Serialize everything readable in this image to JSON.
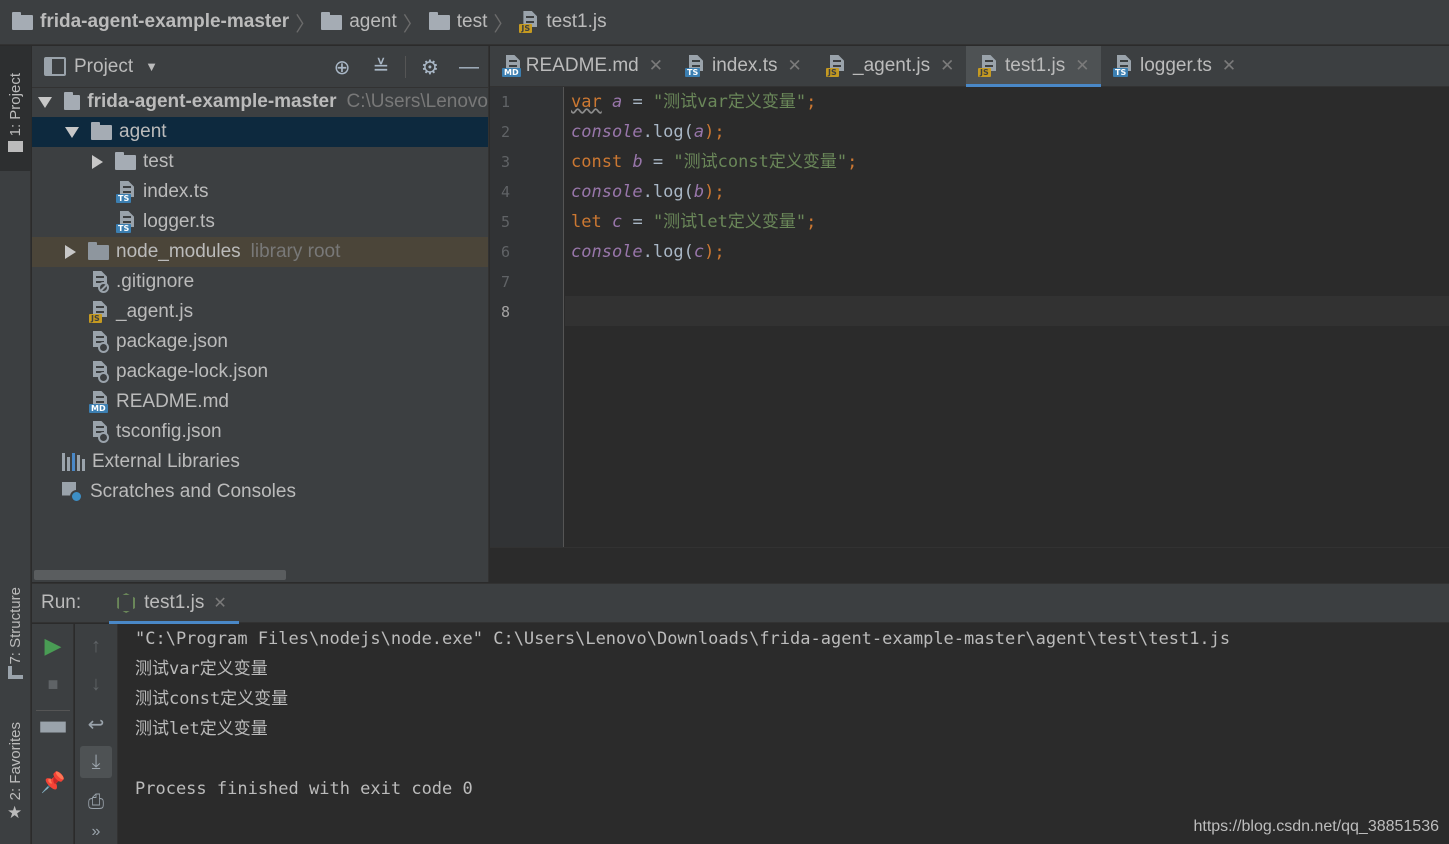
{
  "breadcrumb": [
    "frida-agent-example-master",
    "agent",
    "test",
    "test1.js"
  ],
  "left_strip": {
    "project_tab": "1: Project",
    "structure_tab": "7: Structure",
    "favorites_tab": "2: Favorites"
  },
  "project_panel": {
    "title": "Project",
    "tree": [
      {
        "label": "frida-agent-example-master",
        "hint": "C:\\Users\\Lenovo",
        "icon": "folder-icon",
        "expanded": true
      },
      {
        "label": "agent",
        "icon": "folder-icon",
        "expanded": true,
        "selected": true
      },
      {
        "label": "test",
        "icon": "folder-icon",
        "expanded": false
      },
      {
        "label": "index.ts",
        "icon": "ts-file-icon"
      },
      {
        "label": "logger.ts",
        "icon": "ts-file-icon"
      },
      {
        "label": "node_modules",
        "hint": "library root",
        "icon": "folder-icon",
        "expanded": false
      },
      {
        "label": ".gitignore",
        "icon": "ignore-file-icon"
      },
      {
        "label": "_agent.js",
        "icon": "js-file-icon"
      },
      {
        "label": "package.json",
        "icon": "json-file-icon"
      },
      {
        "label": "package-lock.json",
        "icon": "json-file-icon"
      },
      {
        "label": "README.md",
        "icon": "md-file-icon"
      },
      {
        "label": "tsconfig.json",
        "icon": "json-file-icon"
      },
      {
        "label": "External Libraries",
        "icon": "libraries-icon"
      },
      {
        "label": "Scratches and Consoles",
        "icon": "scratches-icon"
      }
    ]
  },
  "editor_tabs": [
    {
      "label": "README.md",
      "tag": "MD",
      "active": false
    },
    {
      "label": "index.ts",
      "tag": "TS",
      "active": false
    },
    {
      "label": "_agent.js",
      "tag": "JS",
      "active": false
    },
    {
      "label": "test1.js",
      "tag": "JS",
      "active": true
    },
    {
      "label": "logger.ts",
      "tag": "TS",
      "active": false
    }
  ],
  "editor": {
    "line_numbers": [
      "1",
      "2",
      "3",
      "4",
      "5",
      "6",
      "7",
      "8"
    ],
    "current_line": 8,
    "code": {
      "l1": {
        "kw": "var",
        "name": "a",
        "eq": " = ",
        "str": "\"测试var定义变量\"",
        "end": ";"
      },
      "l2": {
        "obj": "console",
        "dot": ".",
        "fn": "log",
        "open": "(",
        "arg": "a",
        "close": ");"
      },
      "l3": {
        "kw": "const",
        "name": "b",
        "eq": " = ",
        "str": "\"测试const定义变量\"",
        "end": ";"
      },
      "l4": {
        "obj": "console",
        "dot": ".",
        "fn": "log",
        "open": "(",
        "arg": "b",
        "close": ");"
      },
      "l5": {
        "kw": "let",
        "name": "c",
        "eq": " = ",
        "str": "\"测试let定义变量\"",
        "end": ";"
      },
      "l6": {
        "obj": "console",
        "dot": ".",
        "fn": "log",
        "open": "(",
        "arg": "c",
        "close": ");"
      }
    }
  },
  "run_panel": {
    "label": "Run:",
    "tab": "test1.js",
    "console": [
      "\"C:\\Program Files\\nodejs\\node.exe\" C:\\Users\\Lenovo\\Downloads\\frida-agent-example-master\\agent\\test\\test1.js",
      "测试var定义变量",
      "测试const定义变量",
      "测试let定义变量",
      "",
      "Process finished with exit code 0"
    ]
  },
  "watermark": "https://blog.csdn.net/qq_38851536"
}
